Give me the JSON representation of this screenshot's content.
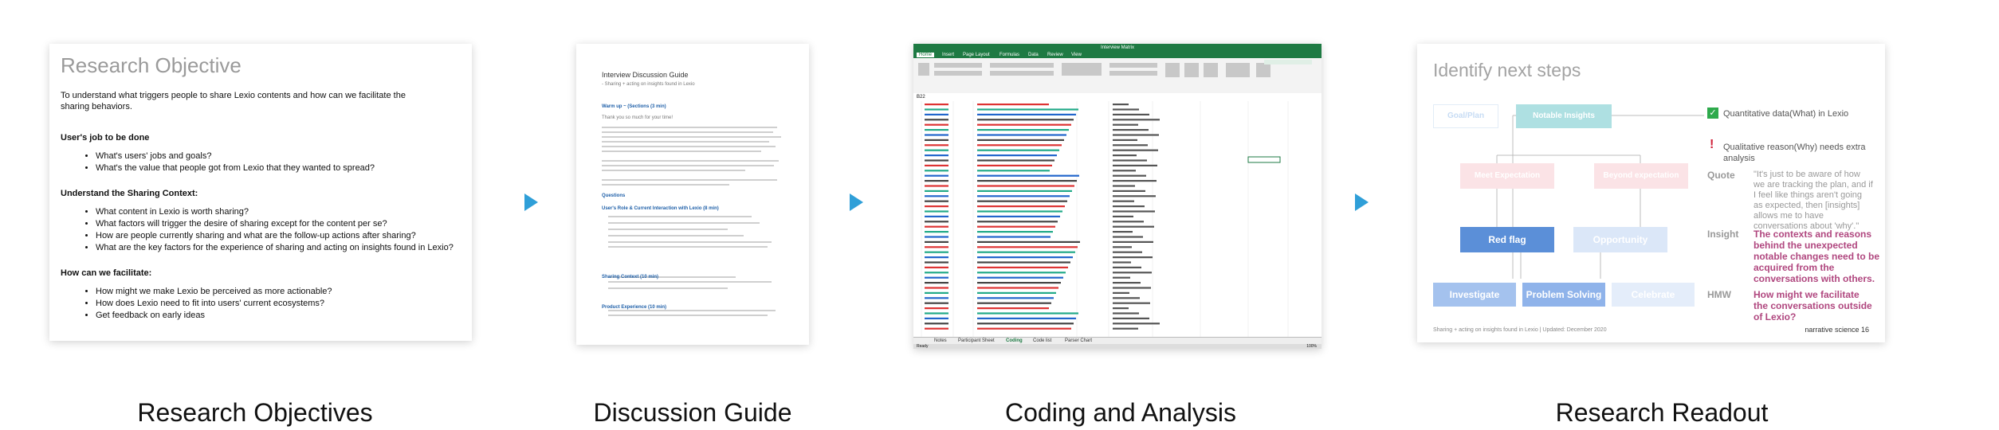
{
  "captions": [
    "Research Objectives",
    "Discussion Guide",
    "Coding and Analysis",
    "Research Readout"
  ],
  "card1": {
    "title": "Research Objective",
    "intro": "To understand what triggers people to share Lexio contents and how can we facilitate the sharing behaviors.",
    "sections": [
      {
        "heading": "User's job to be done",
        "items": [
          "What's users' jobs and goals?",
          "What's the value that people got from Lexio that they wanted to spread?"
        ]
      },
      {
        "heading": "Understand the Sharing Context:",
        "items": [
          "What content in Lexio is worth sharing?",
          "What factors will trigger the desire of sharing except for the content per se?",
          "How are people currently sharing and what are the follow-up actions after sharing?",
          "What are the key factors for the experience of sharing and acting on insights found in Lexio?"
        ]
      },
      {
        "heading": "How can we facilitate:",
        "items": [
          "How might we make Lexio be perceived as more actionable?",
          "How does Lexio need to fit into users' current ecosystems?",
          "Get feedback on early ideas"
        ]
      }
    ]
  },
  "card2": {
    "title": "Interview Discussion Guide",
    "subtitle": "- Sharing + acting on insights found in Lexio",
    "warmup": "Warm up ~ (Sections (3 min)",
    "thanks": "Thank you so much for your time!",
    "questions": "Questions",
    "sec1": "User's Role & Current Interaction with Lexio (8 min)",
    "sec2": "Sharing Context (10 min)",
    "sec3": "Product Experience (10 min)"
  },
  "card3": {
    "window_title": "Interview Matrix",
    "tabs": [
      "Home",
      "Insert",
      "Page Layout",
      "Formulas",
      "Data",
      "Review",
      "View"
    ],
    "sheet_tabs": [
      "Notes",
      "Participant Sheet",
      "Coding",
      "Code list",
      "Parser Chart"
    ],
    "status": "Ready",
    "cell_ref": "B22",
    "zoom": "100%"
  },
  "card4": {
    "title": "Identify next steps",
    "boxes": {
      "goal": "Goal/Plan",
      "notable": "Notable Insights",
      "meet": "Meet Expectation",
      "beyond": "Beyond expectation",
      "redflag": "Red flag",
      "opportunity": "Opportunity",
      "investigate": "Investigate",
      "problem": "Problem Solving",
      "celebrate": "Celebrate"
    },
    "quant": "Quantitative data(What) in Lexio",
    "qual": "Qualitative reason(Why) needs extra analysis",
    "quote_label": "Quote",
    "quote": "\"It's just to be aware of how we are tracking the plan, and if I feel like things aren't going as expected, then [insights] allows me to have conversations about 'why'.\"",
    "insight_label": "Insight",
    "insight": "The contexts and reasons behind the unexpected notable changes need to be acquired from the conversations with others.",
    "hmw_label": "HMW",
    "hmw": "How might we facilitate the conversations outside of Lexio?",
    "footer": "Sharing + acting on insights found in Lexio | Updated: December 2020",
    "brand": "narrative science",
    "page": "16"
  },
  "colors": {
    "arrow": "#2f9fd8",
    "redflag": "#5b8fd8",
    "pink": "#b0477f",
    "excel_green": "#1e7a43"
  }
}
